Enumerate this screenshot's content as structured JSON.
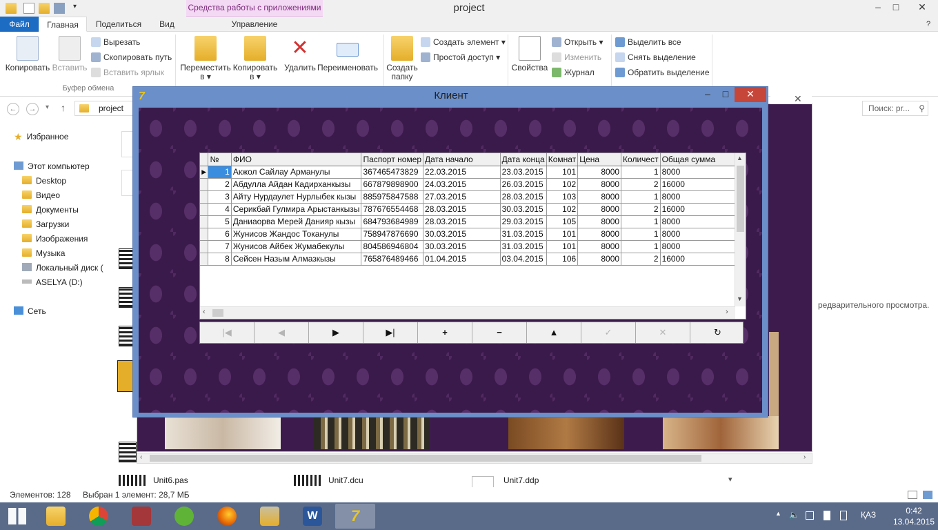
{
  "window": {
    "title": "project",
    "context_tools": "Средства работы с приложениями",
    "minimize": "–",
    "maximize": "□",
    "close": "✕"
  },
  "tabs": {
    "file": "Файл",
    "home": "Главная",
    "share": "Поделиться",
    "view": "Вид",
    "manage": "Управление"
  },
  "ribbon": {
    "copy": "Копировать",
    "paste": "Вставить",
    "cut": "Вырезать",
    "copy_path": "Скопировать путь",
    "paste_shortcut": "Вставить ярлык",
    "clipboard_group": "Буфер обмена",
    "move_to": "Переместить",
    "copy_to": "Копировать",
    "to_suffix": "в ▾",
    "delete": "Удалить",
    "rename": "Переименовать",
    "new_folder_1": "Создать",
    "new_folder_2": "папку",
    "new_item": "Создать элемент ▾",
    "easy_access": "Простой доступ ▾",
    "properties": "Свойства",
    "open": "Открыть ▾",
    "edit": "Изменить",
    "history": "Журнал",
    "select_all": "Выделить все",
    "select_none": "Снять выделение",
    "invert_selection": "Обратить выделение"
  },
  "address": {
    "back": "←",
    "forward": "→",
    "recent": "▾",
    "up": "↑",
    "path": "project",
    "search_placeholder": "Поиск: pr..."
  },
  "navpane": {
    "favorites": "Избранное",
    "this_pc": "Этот компьютер",
    "desktop": "Desktop",
    "videos": "Видео",
    "documents": "Документы",
    "downloads": "Загрузки",
    "pictures": "Изображения",
    "music": "Музыка",
    "local_disk": "Локальный диск (",
    "usb": "ASELYA (D:)",
    "network": "Сеть"
  },
  "files": {
    "unit6pas": "Unit6.pas",
    "unit7dcu": "Unit7.dcu",
    "unit7ddp": "Unit7.ddp",
    "preview_hint": "редварительного просмотра."
  },
  "status": {
    "count": "Элементов: 128",
    "selected": "Выбран 1 элемент: 28,7 МБ"
  },
  "client": {
    "title": "Клиент",
    "logo": "7",
    "columns": [
      "№",
      "ФИО",
      "Паспорт номер",
      "Дата начало",
      "Дата конца",
      "Комнат",
      "Цена",
      "Количест",
      "Общая сумма"
    ],
    "rows": [
      [
        "1",
        "Акжол Сайлау Арманулы",
        "367465473829",
        "22.03.2015",
        "23.03.2015",
        "101",
        "8000",
        "1",
        "8000"
      ],
      [
        "2",
        "Абдулла Айдан Кадирханкызы",
        "667879898900",
        "24.03.2015",
        "26.03.2015",
        "102",
        "8000",
        "2",
        "16000"
      ],
      [
        "3",
        "Айту Нурдаулет Нурлыбек кызы",
        "885975847588",
        "27.03.2015",
        "28.03.2015",
        "103",
        "8000",
        "1",
        "8000"
      ],
      [
        "4",
        "Серикбай Гулмира Арыстанкызы",
        "787676554468",
        "28.03.2015",
        "30.03.2015",
        "102",
        "8000",
        "2",
        "16000"
      ],
      [
        "5",
        "Даниаорва Мерей Данияр кызы",
        "684793684989",
        "28.03.2015",
        "29.03.2015",
        "105",
        "8000",
        "1",
        "8000"
      ],
      [
        "6",
        "Жунисов Жандос Токанулы",
        "758947876690",
        "30.03.2015",
        "31.03.2015",
        "101",
        "8000",
        "1",
        "8000"
      ],
      [
        "7",
        "Жунисов Айбек Жумабекулы",
        "804586946804",
        "30.03.2015",
        "31.03.2015",
        "101",
        "8000",
        "1",
        "8000"
      ],
      [
        "8",
        "Сейсен Назым Алмазкызы",
        "765876489466",
        "01.04.2015",
        "03.04.2015",
        "106",
        "8000",
        "2",
        "16000"
      ]
    ],
    "navigator": [
      "|◀",
      "◀",
      "▶",
      "▶|",
      "+",
      "−",
      "▲",
      "✓",
      "✕",
      "↻"
    ]
  },
  "taskbar": {
    "lang": "ҚАЗ",
    "time": "0:42",
    "date": "13.04.2015"
  }
}
